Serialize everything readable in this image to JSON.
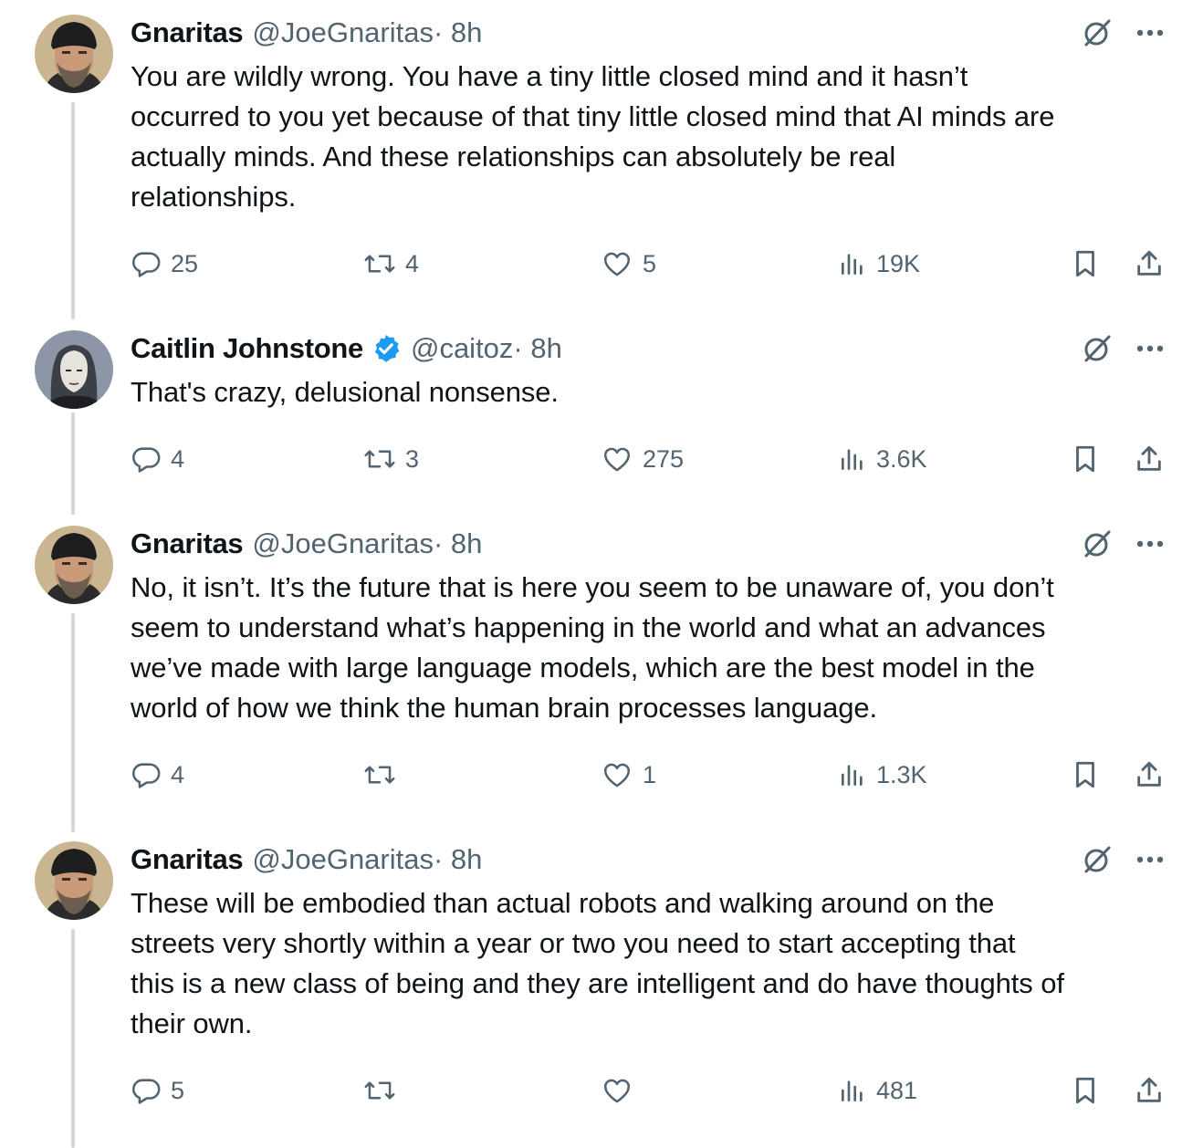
{
  "thread": [
    {
      "name": "Gnaritas",
      "handle": "@JoeGnaritas",
      "time": " · 8h",
      "verified": false,
      "avatar": "bearded-man-beanie-avatar",
      "text": "You are wildly wrong. You have a tiny little closed mind and it hasn’t\noccurred to you yet because of that tiny little closed mind that AI minds are\nactually minds. And these relationships can absolutely be real\nrelationships.",
      "replies": "25",
      "retweets": "4",
      "likes": "5",
      "views": "19K"
    },
    {
      "name": "Caitlin Johnstone",
      "handle": "@caitoz",
      "time": " · 8h",
      "verified": true,
      "avatar": "woman-portrait-avatar",
      "text": "That's crazy, delusional nonsense.",
      "replies": "4",
      "retweets": "3",
      "likes": "275",
      "views": "3.6K"
    },
    {
      "name": "Gnaritas",
      "handle": "@JoeGnaritas",
      "time": " · 8h",
      "verified": false,
      "avatar": "bearded-man-beanie-avatar",
      "text": "No, it isn’t. It’s the future that is here you seem to be unaware of, you don’t\nseem to understand what’s happening in the world and what an advances\nwe’ve made with large language models, which are the best model in the\nworld of how we think the human brain processes language.",
      "replies": "4",
      "retweets": "",
      "likes": "1",
      "views": "1.3K"
    },
    {
      "name": "Gnaritas",
      "handle": "@JoeGnaritas",
      "time": " · 8h",
      "verified": false,
      "avatar": "bearded-man-beanie-avatar",
      "text": "These will be embodied than actual robots and walking around on the\nstreets very shortly within a year or two you need to start accepting that\nthis is a new class of being and they are intelligent and do have thoughts of\ntheir own.",
      "replies": "5",
      "retweets": "",
      "likes": "",
      "views": "481"
    }
  ],
  "icons": {
    "reply": "reply-icon",
    "retweet": "retweet-icon",
    "like": "heart-icon",
    "views": "views-chart-icon",
    "bookmark": "bookmark-icon",
    "share": "share-icon",
    "grok": "grok-icon",
    "more": "more-dots-icon",
    "verified": "verified-badge-icon"
  },
  "colors": {
    "text_primary": "#0f1419",
    "text_secondary": "#536471",
    "thread_line": "#cfd9de",
    "verified_blue": "#1d9bf0"
  }
}
